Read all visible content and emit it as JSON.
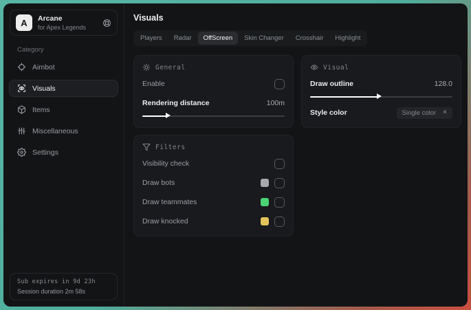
{
  "theme": {
    "desktop_gradient_start": "#57b6a4",
    "desktop_gradient_end": "#c94f40",
    "window_bg": "#131416",
    "panel_bg": "#191a1d",
    "text_primary": "#eceded",
    "text_muted": "#9b9fa5"
  },
  "sidebar": {
    "logo": {
      "letter": "A",
      "title": "Arcane",
      "subtitle": "for Apex Legends",
      "action_icon": "lifebuoy-icon"
    },
    "category_label": "Category",
    "items": [
      {
        "label": "Aimbot",
        "icon": "crosshair-icon",
        "active": false
      },
      {
        "label": "Visuals",
        "icon": "scan-eye-icon",
        "active": true
      },
      {
        "label": "Items",
        "icon": "cube-icon",
        "active": false
      },
      {
        "label": "Miscellaneous",
        "icon": "sliders-icon",
        "active": false
      },
      {
        "label": "Settings",
        "icon": "gear-icon",
        "active": false
      }
    ],
    "footer": {
      "line1": "Sub expires in 9d 23h",
      "line2": "Session duration 2m 58s"
    }
  },
  "main": {
    "title": "Visuals",
    "tabs": [
      {
        "label": "Players",
        "active": false
      },
      {
        "label": "Radar",
        "active": false
      },
      {
        "label": "OffScreen",
        "active": true
      },
      {
        "label": "Skin Changer",
        "active": false
      },
      {
        "label": "Crosshair",
        "active": false
      },
      {
        "label": "Highlight",
        "active": false
      }
    ],
    "panels": [
      {
        "id": "general",
        "title": "General",
        "icon": "sun-icon",
        "column": "left",
        "rows": [
          {
            "label": "Enable",
            "type": "checkbox",
            "checked": false
          },
          {
            "label": "Rendering distance",
            "emphasis": true,
            "type": "slider",
            "value_text": "100m",
            "percent": 20
          }
        ]
      },
      {
        "id": "filters",
        "title": "Filters",
        "icon": "funnel-icon",
        "column": "left",
        "rows": [
          {
            "label": "Visibility check",
            "type": "checkbox",
            "checked": false
          },
          {
            "label": "Draw bots",
            "type": "checkbox",
            "checked": false,
            "swatch": "#a8a9ac"
          },
          {
            "label": "Draw teammates",
            "type": "checkbox",
            "checked": false,
            "swatch": "#4bd374"
          },
          {
            "label": "Draw knocked",
            "type": "checkbox",
            "checked": false,
            "swatch": "#e4c35a"
          }
        ]
      },
      {
        "id": "visual",
        "title": "Visual",
        "icon": "eye-icon",
        "column": "right",
        "rows": [
          {
            "label": "Draw outline",
            "emphasis": true,
            "type": "slider",
            "value_text": "128.0",
            "percent": 50
          },
          {
            "label": "Style color",
            "emphasis": true,
            "type": "chip",
            "chip_label": "Single color",
            "chip_close": "×"
          }
        ]
      }
    ]
  }
}
